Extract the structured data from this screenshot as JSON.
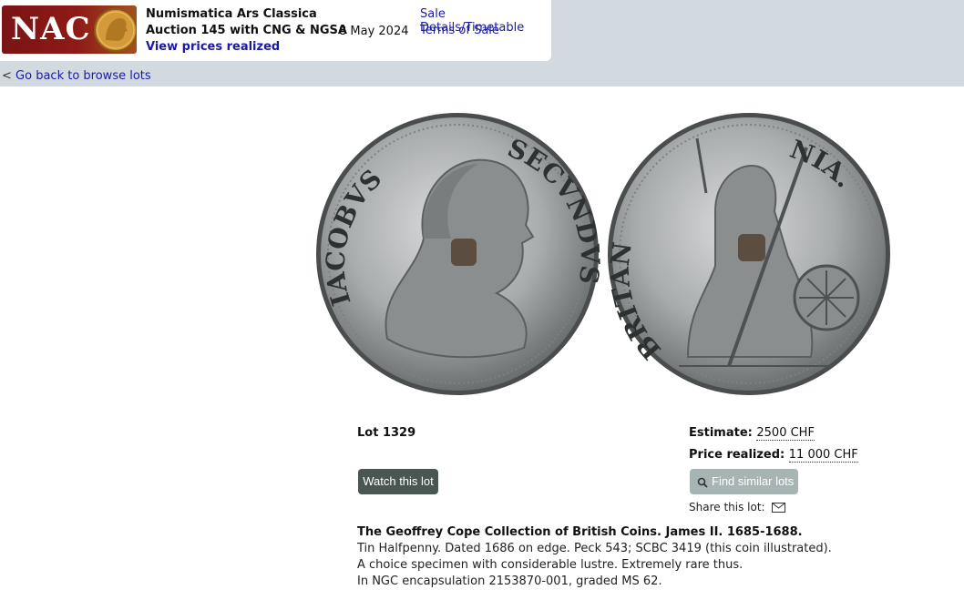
{
  "header": {
    "logo_text": "NAC",
    "title": "Numismatica Ars Classica",
    "subtitle": "Auction 145 with CNG & NGSA",
    "date": "8 May 2024",
    "prices_link": "View prices realized",
    "sale_details_link": "Sale Details/Timetable",
    "terms_link": "Terms of Sale"
  },
  "nav": {
    "back_prefix": "<",
    "back_link": "Go back to browse lots"
  },
  "coins": {
    "obverse_legend_left": "IACOBVS",
    "obverse_legend_right": "SECVNDVS",
    "reverse_legend_left": "BRITAN",
    "reverse_legend_right": "NIA."
  },
  "lot": {
    "label": "Lot 1329",
    "estimate_label": "Estimate:",
    "estimate_value": "2500 CHF",
    "price_label": "Price realized:",
    "price_value": "11 000 CHF",
    "watch_button": "Watch this lot",
    "find_button": "Find similar lots",
    "share_label": "Share this lot:"
  },
  "description": {
    "title": "The Geoffrey Cope Collection of British Coins. James II. 1685-1688.",
    "lines": [
      "Tin Halfpenny. Dated 1686 on edge. Peck 543; SCBC 3419 (this coin illustrated).",
      "A choice specimen with considerable lustre. Extremely rare thus.",
      "In NGC encapsulation 2153870-001, graded MS 62."
    ]
  },
  "colors": {
    "topbar": "#d3dadf",
    "logo_red": "#8e1a16",
    "link_blue": "#1a1aa6",
    "watch_button": "#4a5651",
    "find_button": "#a6b5b3"
  }
}
